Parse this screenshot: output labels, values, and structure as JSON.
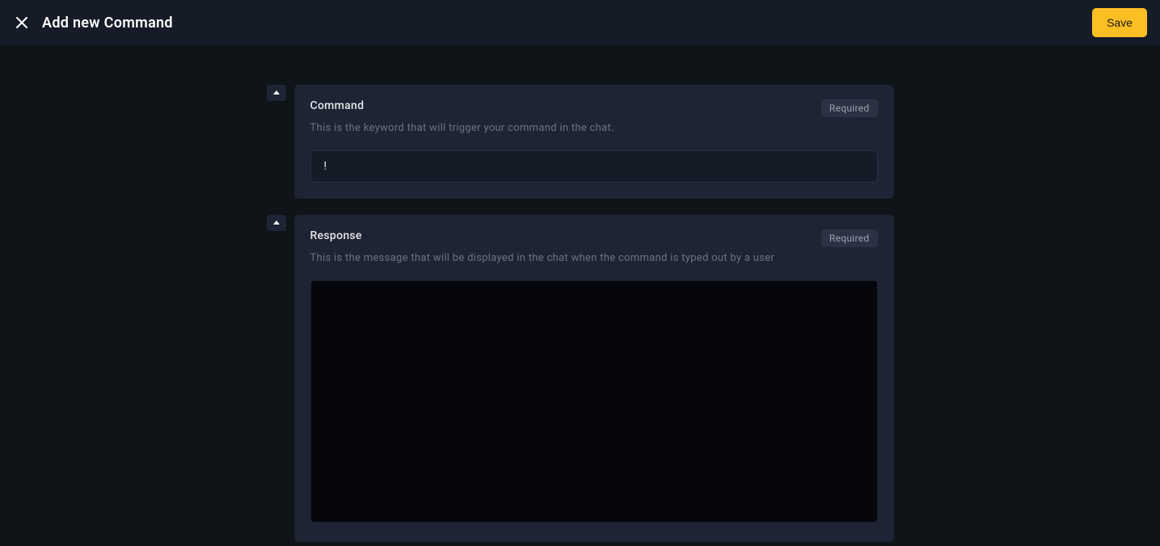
{
  "header": {
    "title": "Add new Command",
    "save_label": "Save"
  },
  "sections": {
    "command": {
      "title": "Command",
      "description": "This is the keyword that will trigger your command in the chat.",
      "badge": "Required",
      "value": "!"
    },
    "response": {
      "title": "Response",
      "description": "This is the message that will be displayed in the chat when the command is typed out by a user",
      "badge": "Required",
      "value": ""
    }
  }
}
